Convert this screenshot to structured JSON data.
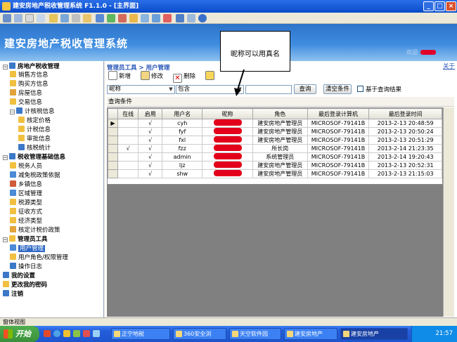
{
  "window": {
    "title": "建安房地产税收管理系统 F1.1.0 - [主界面]",
    "min_label": "_",
    "max_label": "□",
    "close_label": "×"
  },
  "banner": {
    "title": "建安房地产税收管理系统",
    "user_label": "欢迎",
    "about": "关于"
  },
  "callout": {
    "text": "昵称可以用真名"
  },
  "tree": {
    "items": [
      {
        "label": "房地产税收管理",
        "bold": true
      },
      {
        "label": "销售方信息"
      },
      {
        "label": "购买方信息"
      },
      {
        "label": "房屋信息"
      },
      {
        "label": "交易信息"
      },
      {
        "label": "计核税信息"
      },
      {
        "label": "核定价格"
      },
      {
        "label": "计税信息"
      },
      {
        "label": "审批信息"
      },
      {
        "label": "核税统计"
      },
      {
        "label": "税收管理基础信息",
        "bold": true
      },
      {
        "label": "税务人员"
      },
      {
        "label": "减免税政策依据"
      },
      {
        "label": "乡镇信息"
      },
      {
        "label": "区域管理"
      },
      {
        "label": "税源类型"
      },
      {
        "label": "征收方式"
      },
      {
        "label": "经济类型"
      },
      {
        "label": "核定计税价政策"
      },
      {
        "label": "管理员工具",
        "bold": true
      },
      {
        "label": "用户管理",
        "selected": true
      },
      {
        "label": "用户角色/权限管理"
      },
      {
        "label": "操作日志"
      },
      {
        "label": "我的设置",
        "bold": true
      },
      {
        "label": "更改我的密码",
        "bold": true
      },
      {
        "label": "注销",
        "bold": true
      }
    ]
  },
  "breadcrumb": "管理员工具 > 用户管理",
  "toolbar": {
    "add": "新增",
    "edit": "修改",
    "delete": "删除"
  },
  "filter": {
    "field": "昵称",
    "op": "包含",
    "value": "",
    "query": "查询",
    "clear": "清空条件",
    "base_on_result": "基于查询结果",
    "cond_label": "查询条件"
  },
  "grid": {
    "columns": [
      "在线",
      "启用",
      "用户名",
      "昵称",
      "角色",
      "最后登录计算机",
      "最后登录时间"
    ],
    "rows": [
      {
        "online": "",
        "enabled": "√",
        "username": "cyh",
        "nickname": "",
        "role": "建安房地产管理员",
        "computer": "MICROSOF-79141B",
        "time": "2013-2-13 20:48:59"
      },
      {
        "online": "",
        "enabled": "√",
        "username": "fyf",
        "nickname": "",
        "role": "建安房地产管理员",
        "computer": "MICROSOF-79141B",
        "time": "2013-2-13 20:50:24"
      },
      {
        "online": "",
        "enabled": "√",
        "username": "fxl",
        "nickname": "",
        "role": "建安房地产管理员",
        "computer": "MICROSOF-79141B",
        "time": "2013-2-13 20:51:29"
      },
      {
        "online": "√",
        "enabled": "√",
        "username": "fzz",
        "nickname": "",
        "role": "所长岗",
        "computer": "MICROSOF-79141B",
        "time": "2013-2-14 21:23:35"
      },
      {
        "online": "",
        "enabled": "√",
        "username": "admin",
        "nickname": "",
        "role": "系统管理员",
        "computer": "MICROSOF-79141B",
        "time": "2013-2-14 19:20:43"
      },
      {
        "online": "",
        "enabled": "√",
        "username": "ljz",
        "nickname": "",
        "role": "建安房地产管理员",
        "computer": "MICROSOF-79141B",
        "time": "2013-2-13 20:52:31"
      },
      {
        "online": "",
        "enabled": "√",
        "username": "shw",
        "nickname": "",
        "role": "建安房地产管理员",
        "computer": "MICROSOF-79141B",
        "time": "2013-2-13 21:15:03"
      }
    ]
  },
  "status": {
    "text": "窗体视图"
  },
  "taskbar": {
    "start": "开始",
    "apps": [
      {
        "label": "正宁地税"
      },
      {
        "label": "360安全浏"
      },
      {
        "label": "天空软件园"
      },
      {
        "label": "建安房地产"
      },
      {
        "label": "建安房地产",
        "active": true
      }
    ],
    "clock": "21:57"
  },
  "colors": {
    "titlebar": "#0a4bc9",
    "banner": "#3f8ce0",
    "selection": "#316ac5",
    "redact": "#e3001b",
    "taskbar": "#245edb"
  }
}
